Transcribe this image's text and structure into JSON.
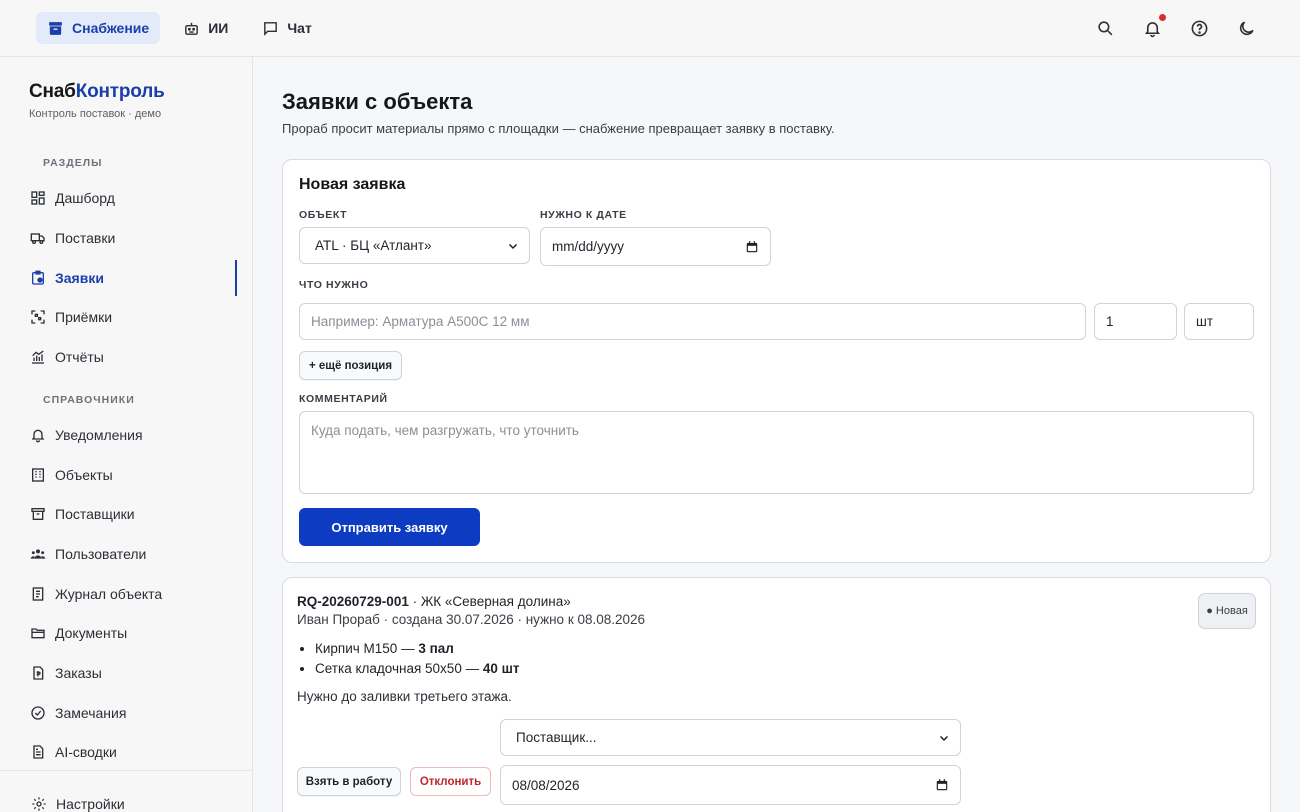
{
  "topbar": {
    "tabs": [
      {
        "label": "Снабжение",
        "icon": "archive-icon",
        "active": true
      },
      {
        "label": "ИИ",
        "icon": "robot-icon",
        "active": false
      },
      {
        "label": "Чат",
        "icon": "chat-icon",
        "active": false
      }
    ],
    "icons": [
      "search-icon",
      "bell-icon",
      "help-icon",
      "moon-icon"
    ],
    "notification_dot_color": "#d62d2d"
  },
  "sidebar": {
    "brand_part1": "Снаб",
    "brand_part2": "Контроль",
    "brand_sub": "Контроль поставок · демо",
    "section1": "РАЗДЕЛЫ",
    "section2": "СПРАВОЧНИКИ",
    "items": [
      {
        "label": "Дашборд",
        "icon": "dashboard-icon"
      },
      {
        "label": "Поставки",
        "icon": "truck-icon"
      },
      {
        "label": "Заявки",
        "icon": "clipboard-icon",
        "active": true
      },
      {
        "label": "Приёмки",
        "icon": "scan-icon"
      },
      {
        "label": "Отчёты",
        "icon": "chart-icon"
      }
    ],
    "ref_items": [
      {
        "label": "Уведомления",
        "icon": "bell-icon"
      },
      {
        "label": "Объекты",
        "icon": "building-icon"
      },
      {
        "label": "Поставщики",
        "icon": "archive-icon"
      },
      {
        "label": "Пользователи",
        "icon": "users-icon"
      },
      {
        "label": "Журнал объекта",
        "icon": "journal-icon"
      },
      {
        "label": "Документы",
        "icon": "folder-icon"
      },
      {
        "label": "Заказы",
        "icon": "order-icon"
      },
      {
        "label": "Замечания",
        "icon": "check-circle-icon"
      },
      {
        "label": "AI-сводки",
        "icon": "file-text-icon"
      }
    ],
    "settings": "Настройки",
    "accent": "#1a3fa9"
  },
  "main": {
    "title": "Заявки с объекта",
    "subtitle": "Прораб просит материалы прямо с площадки — снабжение превращает заявку в поставку."
  },
  "form": {
    "title": "Новая заявка",
    "object_label": "ОБЪЕКТ",
    "object_value": "ATL · БЦ «Атлант»",
    "date_label": "НУЖНО К ДАТЕ",
    "date_placeholder": "mm/dd/yyyy",
    "need_label": "ЧТО НУЖНО",
    "item_placeholder": "Например: Арматура А500С 12 мм",
    "qty_value": "1",
    "unit_value": "шт",
    "add_position": "+ ещё позиция",
    "comment_label": "КОММЕНТАРИЙ",
    "comment_placeholder": "Куда подать, чем разгружать, что уточнить",
    "submit": "Отправить заявку",
    "primary_color": "#0d3cc2"
  },
  "request": {
    "id": "RQ-20260729-001",
    "object": " · ЖК «Северная долина»",
    "meta": "Иван Прораб · создана 30.07.2026 · нужно к 08.08.2026",
    "status": "● Новая",
    "items": [
      {
        "name": "Кирпич М150 — ",
        "qty": "3 пал"
      },
      {
        "name": "Сетка кладочная 50х50 — ",
        "qty": "40 шт"
      }
    ],
    "note": "Нужно до заливки третьего этажа.",
    "supplier_placeholder": "Поставщик...",
    "date_value": "08/08/2026",
    "take_button": "Взять в работу",
    "reject_button": "Отклонить"
  }
}
